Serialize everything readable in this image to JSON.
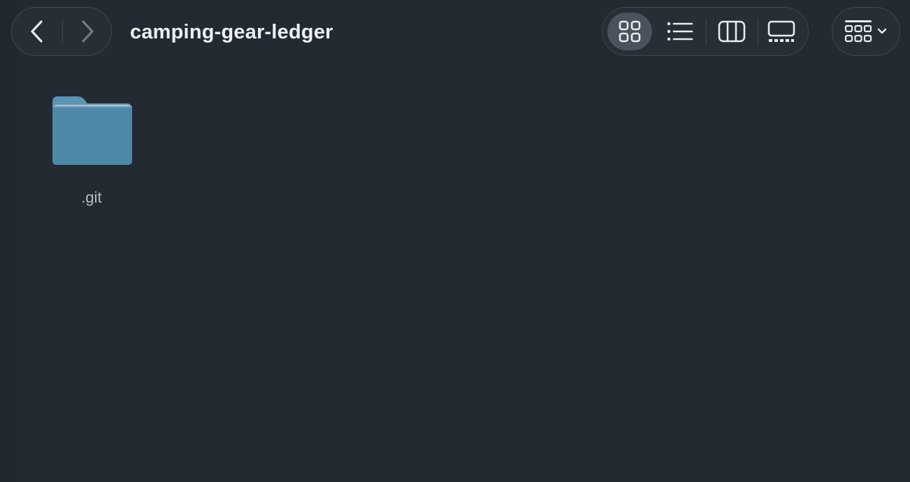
{
  "window": {
    "title": "camping-gear-ledger"
  },
  "toolbar": {
    "nav": {
      "back_icon": "chevron-left-icon",
      "forward_icon": "chevron-right-icon"
    },
    "view_modes": [
      {
        "name": "icons",
        "icon": "grid-icon",
        "active": true
      },
      {
        "name": "list",
        "icon": "list-icon",
        "active": false
      },
      {
        "name": "columns",
        "icon": "columns-icon",
        "active": false
      },
      {
        "name": "gallery",
        "icon": "gallery-icon",
        "active": false
      }
    ],
    "group_icon": "group-by-grid-icon"
  },
  "files": [
    {
      "name": ".git",
      "type": "folder",
      "icon": "folder-icon"
    }
  ],
  "colors": {
    "background": "#232a32",
    "folder": "#4f88a8",
    "folder_tab": "#5a94b4",
    "text_primary": "#eef1f4",
    "text_secondary": "#b8bec4"
  }
}
